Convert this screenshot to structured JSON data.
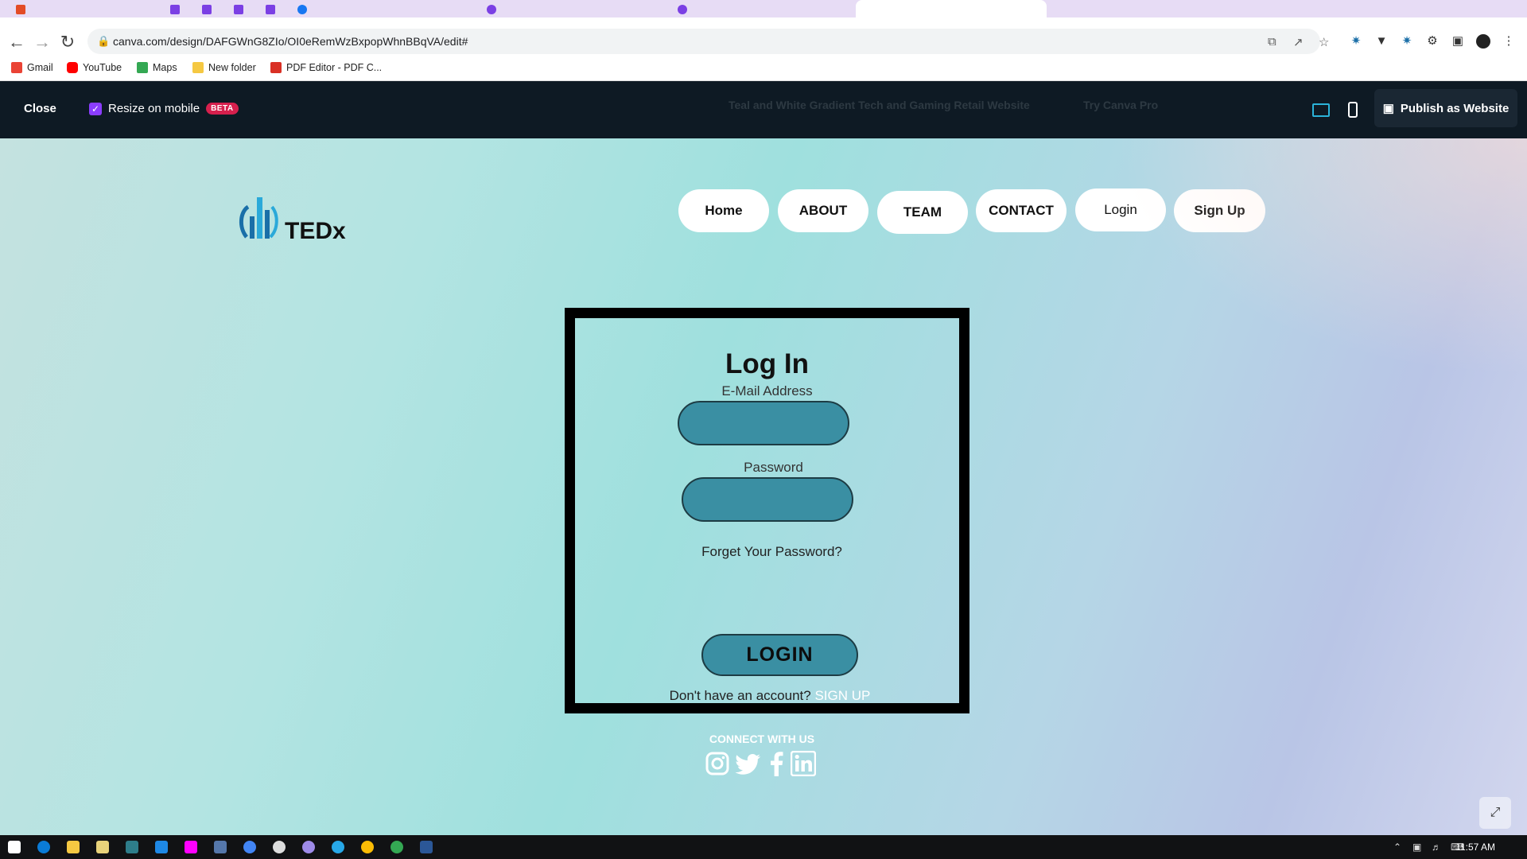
{
  "browser": {
    "url": "canva.com/design/DAFGWnG8ZIo/OI0eRemWzBxpopWhnBBqVA/edit#",
    "bookmarks": [
      "Gmail",
      "YouTube",
      "Maps",
      "New folder",
      "PDF Editor - PDF C..."
    ]
  },
  "canva_bar": {
    "close_label": "Close",
    "resize_label": "Resize on mobile",
    "beta_badge": "BETA",
    "design_title": "Teal and White Gradient Tech and Gaming Retail Website",
    "try_pro": "Try Canva Pro",
    "publish_label": "Publish as Website",
    "accent_color": "#8b3dff"
  },
  "site": {
    "logo_text": "TEDx",
    "nav": [
      "Home",
      "ABOUT",
      "TEAM",
      "CONTACT",
      "Login",
      "Sign Up"
    ],
    "login": {
      "title": "Log In",
      "email_label": "E-Mail Address",
      "password_label": "Password",
      "forgot": "Forget Your Password?",
      "button": "LOGIN",
      "no_account": "Don't have an account?",
      "signup_link": "SIGN UP"
    },
    "connect": "CONNECT WITH US",
    "social_icons": [
      "instagram-icon",
      "twitter-icon",
      "facebook-icon",
      "linkedin-icon"
    ]
  },
  "taskbar": {
    "time": "11:57 AM"
  }
}
